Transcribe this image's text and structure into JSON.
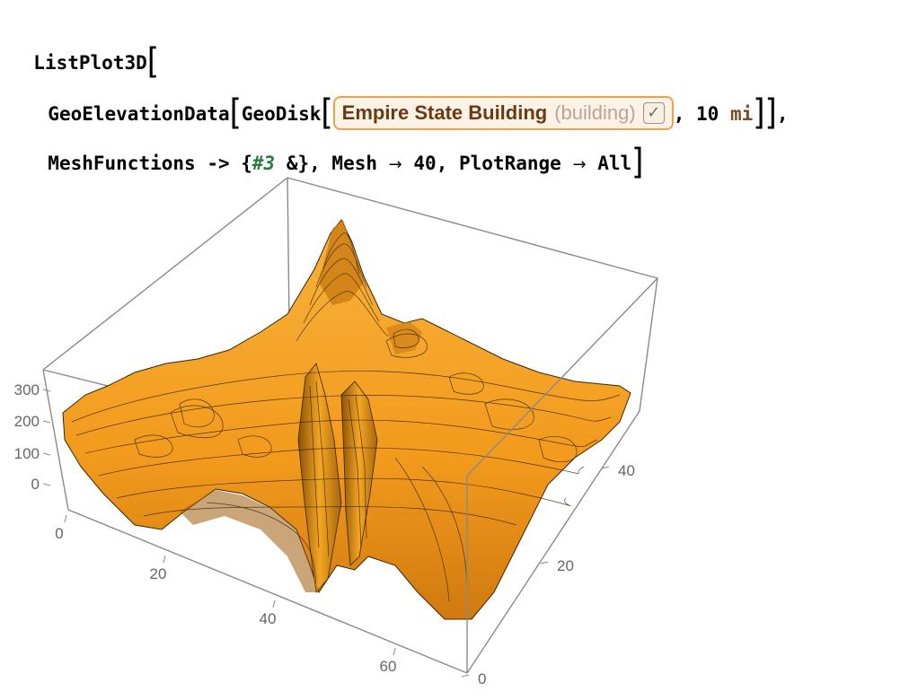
{
  "code": {
    "line1": {
      "func": "ListPlot3D"
    },
    "line2": {
      "func_geoelev": "GeoElevationData",
      "func_geodisk": "GeoDisk",
      "entity": {
        "name": "Empire State Building",
        "type": "(building)",
        "check": "✓"
      },
      "sep": ", ",
      "quantity_value": "10",
      "quantity_unit": "mi",
      "trail": ","
    },
    "line3": {
      "mesh_functions": "MeshFunctions",
      "arrow_rule": " -> ",
      "open_brace": "{",
      "slot": "#3",
      "slot_tail": " &}, ",
      "mesh": "Mesh",
      "rule_arrow": "→",
      "mesh_value": "40",
      "sep": ", ",
      "plot_range": "PlotRange",
      "plot_range_value": "All"
    }
  },
  "plot": {
    "z_ticks": [
      "300",
      "200",
      "100",
      "0"
    ],
    "x_ticks": [
      "0",
      "20",
      "40",
      "60"
    ],
    "y_ticks": [
      "0",
      "20",
      "40"
    ],
    "colors": {
      "surface": "#f5a623",
      "surface_dark": "#c97a12",
      "contour": "#3a2410",
      "box": "#8a8a8a"
    }
  }
}
